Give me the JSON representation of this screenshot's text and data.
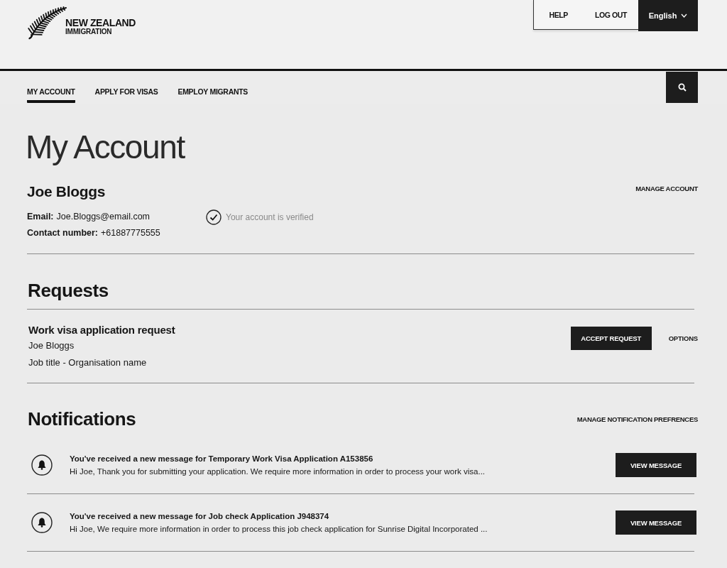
{
  "header": {
    "logo": {
      "title": "NEW ZEALAND",
      "subtitle": "IMMIGRATION"
    },
    "utility_links": [
      "HELP",
      "LOG OUT"
    ],
    "language": {
      "value": "English"
    }
  },
  "nav": {
    "tabs": [
      {
        "label": "MY ACCOUNT",
        "selected": true
      },
      {
        "label": "APPLY FOR VISAS",
        "selected": false
      },
      {
        "label": "EMPLOY MIGRANTS",
        "selected": false
      }
    ]
  },
  "page_title": "My Account",
  "profile": {
    "name": "Joe Bloggs",
    "manage_link": "MANAGE ACCOUNT",
    "fields": [
      {
        "label": "Email:",
        "value": "Joe.Bloggs@email.com"
      },
      {
        "label": "Contact number:",
        "value": "+61887775555"
      }
    ],
    "verification": {
      "verified": true,
      "text": "Your account is verified"
    }
  },
  "requests": {
    "title": "Requests",
    "items": [
      {
        "title": "Work visa application request",
        "lines": [
          "Joe Bloggs",
          "Job title - Organisation name"
        ],
        "primary_action": "ACCEPT REQUEST",
        "secondary_action": "OPTIONS"
      }
    ]
  },
  "notifications": {
    "title": "Notifications",
    "manage_link": "MANAGE NOTIFICATION PREFRENCES",
    "items": [
      {
        "title": "You've received a new message for Temporary Work Visa Application A153856",
        "body": "Hi Joe, Thank you for submitting your application. We require more information in order to process your work visa...",
        "action": "VIEW MESSAGE"
      },
      {
        "title": "You've received a new message for Job check Application J948374",
        "body": "Hi Joe, We require more information in order to process this job check application for Sunrise Digital Incorporated ...",
        "action": "VIEW MESSAGE"
      }
    ]
  }
}
